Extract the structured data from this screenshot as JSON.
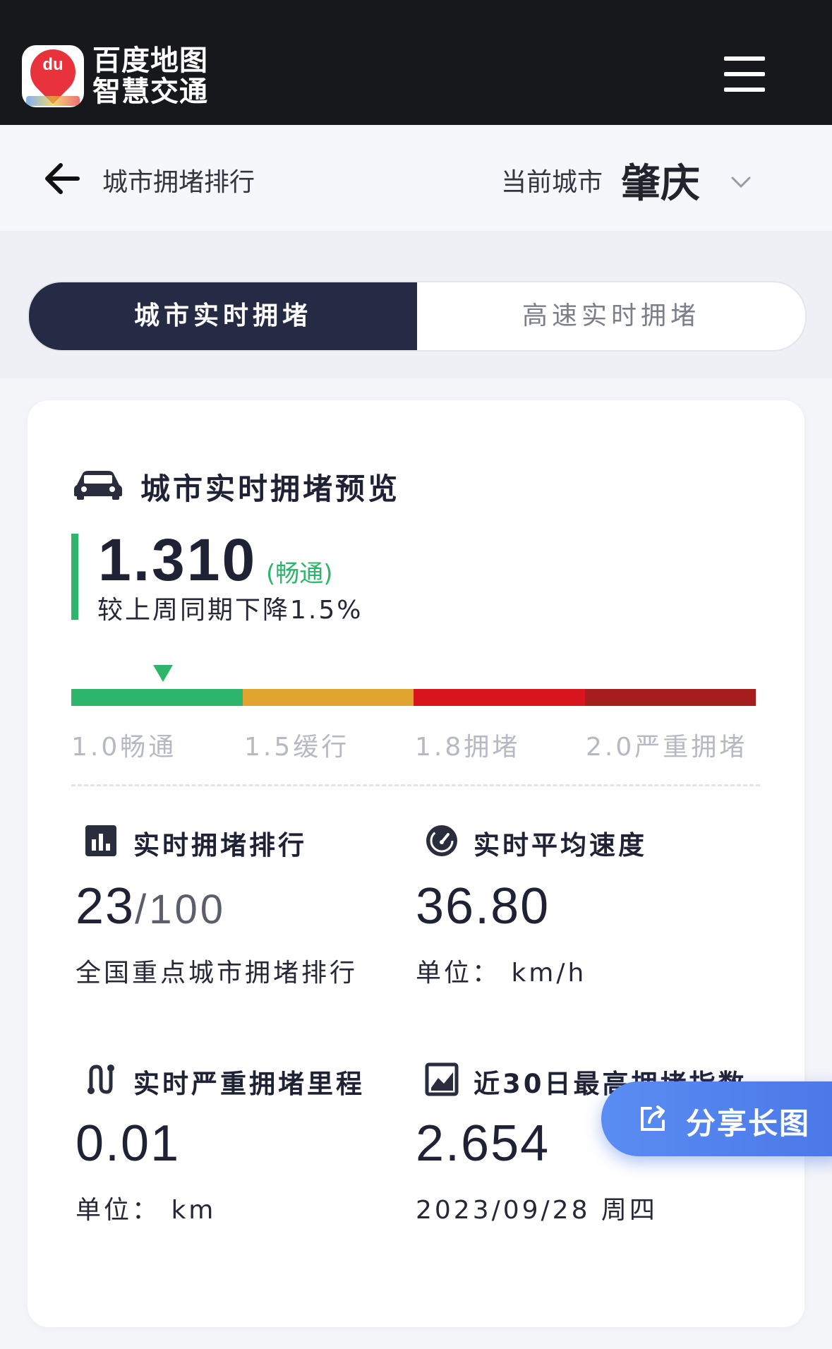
{
  "app": {
    "logo_text_line1": "百度地图",
    "logo_text_line2": "智慧交通",
    "logo_badge": "du"
  },
  "header": {
    "title": "城市拥堵排行",
    "city_label": "当前城市",
    "city_name": "肇庆"
  },
  "tabs": [
    {
      "label": "城市实时拥堵",
      "active": true
    },
    {
      "label": "高速实时拥堵",
      "active": false
    }
  ],
  "overview": {
    "title": "城市实时拥堵预览",
    "index_value": "1.310",
    "index_status": "(畅通)",
    "change_text": "较上周同期下降1.5%",
    "scale_labels": [
      "1.0畅通",
      "1.5缓行",
      "1.8拥堵",
      "2.0严重拥堵"
    ],
    "scale_colors": [
      "#2db56b",
      "#e0a52e",
      "#d9141d",
      "#a51d1d"
    ]
  },
  "stats": {
    "rank": {
      "title": "实时拥堵排行",
      "value": "23",
      "total": "/100",
      "sub": "全国重点城市拥堵排行"
    },
    "speed": {
      "title": "实时平均速度",
      "value": "36.80",
      "sub": "单位： km/h"
    },
    "mileage": {
      "title": "实时严重拥堵里程",
      "value": "0.01",
      "sub": "单位： km"
    },
    "peak": {
      "title": "近30日最高拥堵指数",
      "value": "2.654",
      "sub": "2023/09/28 周四"
    }
  },
  "share": {
    "label": "分享长图"
  },
  "icons": {
    "menu": "menu-icon",
    "back": "arrow-left-icon",
    "city_dropdown": "chevron-down-icon",
    "car": "car-icon",
    "rank": "bar-chart-icon",
    "speed": "speedometer-icon",
    "mileage": "route-icon",
    "peak": "line-chart-icon",
    "share": "share-icon"
  }
}
